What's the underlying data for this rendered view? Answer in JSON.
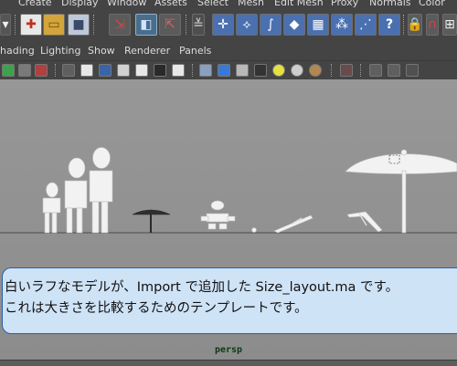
{
  "menubar": {
    "items": [
      "Create",
      "Display",
      "Window",
      "Assets",
      "Select",
      "Mesh",
      "Edit Mesh",
      "Proxy",
      "Normals",
      "Color"
    ]
  },
  "shelf": {
    "icons": [
      "dropdown-arrow",
      "new-scene",
      "open-scene",
      "save-scene",
      "select-by-hierarchy",
      "select-by-object",
      "select-by-component",
      "lock-selection",
      "move-tool",
      "joint-tool",
      "curve-tool",
      "plane-tool",
      "lattice-tool",
      "cube-grid-tool",
      "help-question",
      "padlock",
      "magnet-snap",
      "snap-grid"
    ]
  },
  "panel_menubar": {
    "items": [
      "hading",
      "Lighting",
      "Show",
      "Renderer",
      "Panels"
    ]
  },
  "panel_toolbar": {
    "icons": [
      "camera-attributes",
      "bookmark",
      "image-plane",
      "grid-toggle",
      "film-gate",
      "resolution-gate",
      "field-chart",
      "safe-action",
      "title-safe",
      "wireframe",
      "smooth-shade",
      "textured",
      "use-lights",
      "shadows",
      "ambient-occlusion",
      "isolate-select",
      "xray",
      "xray-joints",
      "xray-active"
    ]
  },
  "viewport": {
    "camera_label": "persp",
    "colors": {
      "background": "#8f8f8f",
      "model": "#f2f2f2",
      "shadow": "#5a5a5a"
    }
  },
  "caption": {
    "line1": "白いラフなモデルが、Import で追加した Size_layout.ma です。",
    "line2": "これは大きさを比較するためのテンプレートです。"
  }
}
